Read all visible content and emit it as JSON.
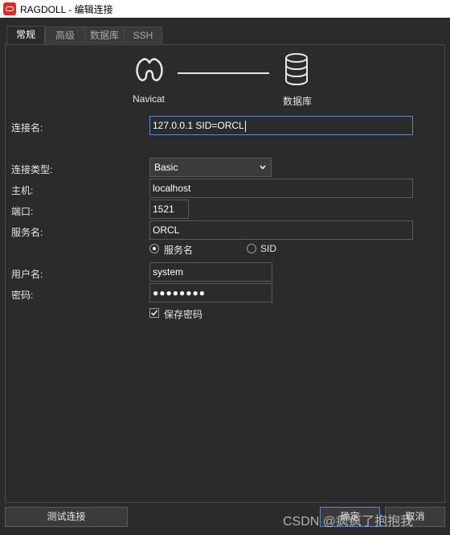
{
  "window": {
    "title": "RAGDOLL - 编辑连接"
  },
  "tabs": [
    {
      "label": "常规"
    },
    {
      "label": "高级"
    },
    {
      "label": "数据库"
    },
    {
      "label": "SSH"
    }
  ],
  "header": {
    "left_label": "Navicat",
    "right_label": "数据库"
  },
  "form": {
    "connection_name_label": "连接名:",
    "connection_name_value": "127.0.0.1 SID=ORCL",
    "connection_type_label": "连接类型:",
    "connection_type_value": "Basic",
    "host_label": "主机:",
    "host_value": "localhost",
    "port_label": "端口:",
    "port_value": "1521",
    "service_label": "服务名:",
    "service_value": "ORCL",
    "radio_service_name": "服务名",
    "radio_sid": "SID",
    "username_label": "用户名:",
    "username_value": "system",
    "password_label": "密码:",
    "password_value": "●●●●●●●●",
    "save_password_label": "保存密码",
    "save_password_checked": true
  },
  "footer": {
    "test_connection_label": "测试连接",
    "ok_label": "确定",
    "cancel_label": "取消"
  },
  "watermark": "CSDN @疯疯了抱抱我",
  "colors": {
    "background": "#2b2b2b",
    "focus_border": "#5d86c4",
    "brand_red": "#e02a2a"
  }
}
